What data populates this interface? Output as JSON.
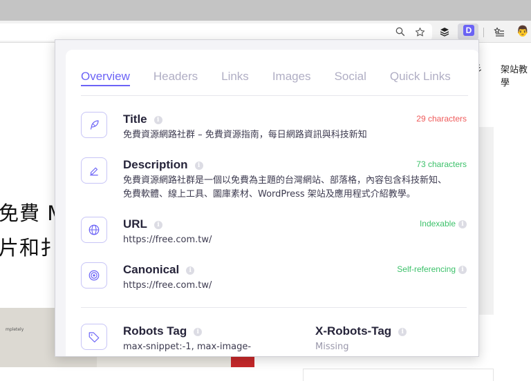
{
  "browser": {
    "extension_letter": "D",
    "avatar_emoji": "👨"
  },
  "background_page": {
    "nav_fragment_1": "彡",
    "nav_fragment_2": "架站教學",
    "headline_line1": "免費 M",
    "headline_line2": "片和扌",
    "image_caption": "mpletely"
  },
  "tabs": [
    {
      "label": "Overview",
      "active": true
    },
    {
      "label": "Headers",
      "active": false
    },
    {
      "label": "Links",
      "active": false
    },
    {
      "label": "Images",
      "active": false
    },
    {
      "label": "Social",
      "active": false
    },
    {
      "label": "Quick Links",
      "active": false
    }
  ],
  "overview": {
    "title": {
      "label": "Title",
      "value": "免費資源網路社群 – 免費資源指南，每日網路資訊與科技新知",
      "status": "29 characters",
      "status_color": "#ef5a5a",
      "icon": "feather-icon"
    },
    "description": {
      "label": "Description",
      "value_line1": "免費資源網路社群是一個以免費為主題的台灣網站、部落格，內容包含科技新知、",
      "value_line2": "免費軟體、線上工具、圖庫素材、WordPress 架站及應用程式介紹教學。",
      "status": "73 characters",
      "status_color": "#3cc16a",
      "icon": "pencil-icon"
    },
    "url": {
      "label": "URL",
      "value": "https://free.com.tw/",
      "status": "Indexable",
      "status_color": "#3cc16a",
      "icon": "globe-icon"
    },
    "canonical": {
      "label": "Canonical",
      "value": "https://free.com.tw/",
      "status": "Self-referencing",
      "status_color": "#3cc16a",
      "icon": "target-icon"
    },
    "robots_tag": {
      "label": "Robots Tag",
      "value": "max-snippet:-1, max-image-",
      "icon": "tag-icon"
    },
    "x_robots_tag": {
      "label": "X-Robots-Tag",
      "value": "Missing"
    }
  },
  "colors": {
    "accent": "#6b63f6",
    "tab_inactive": "#b0aec4",
    "status_red": "#ef5a5a",
    "status_green": "#3cc16a"
  }
}
